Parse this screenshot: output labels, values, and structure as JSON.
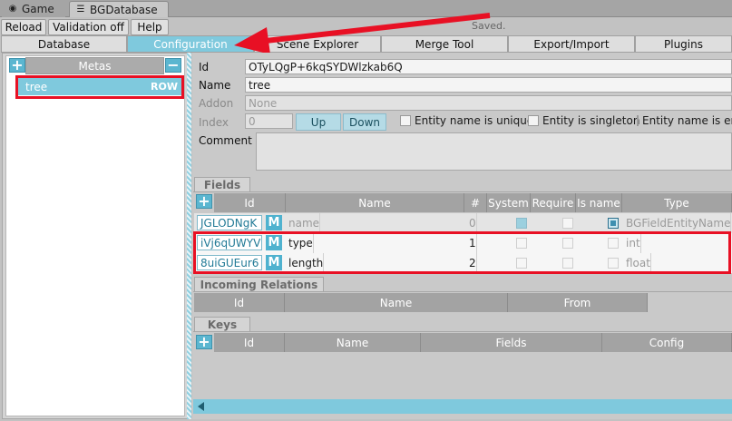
{
  "window_tabs": [
    {
      "label": "Game",
      "icon": "gamepad-icon"
    },
    {
      "label": "BGDatabase",
      "icon": "list-icon"
    }
  ],
  "toolbar": {
    "reload": "Reload",
    "validation": "Validation off",
    "help": "Help",
    "status": "Saved."
  },
  "nav_tabs": [
    "Database",
    "Configuration",
    "Scene Explorer",
    "Merge Tool",
    "Export/Import",
    "Plugins"
  ],
  "nav_selected": "Configuration",
  "metas": {
    "header": "Metas",
    "items": [
      {
        "name": "tree",
        "kind": "ROW"
      }
    ]
  },
  "form": {
    "id_label": "Id",
    "id_value": "OTyLQgP+6kqSYDWlzkab6Q",
    "name_label": "Name",
    "name_value": "tree",
    "addon_label": "Addon",
    "addon_value": "None",
    "index_label": "Index",
    "index_value": "0",
    "up_label": "Up",
    "down_label": "Down",
    "checks": [
      "Entity name is unique",
      "Entity is singleton",
      "Entity name is em"
    ],
    "comment_label": "Comment"
  },
  "fields": {
    "tab": "Fields",
    "columns": [
      "Id",
      "Name",
      "#",
      "System",
      "Require",
      "Is name",
      "Type"
    ],
    "rows": [
      {
        "id": "JGLODNgK",
        "name": "name",
        "num": "0",
        "system": true,
        "require": false,
        "isname": true,
        "type": "BGFieldEntityName",
        "dim": true
      },
      {
        "id": "iVj6qUWYV",
        "name": "type",
        "num": "1",
        "system": false,
        "require": false,
        "isname": false,
        "type": "int",
        "dim": false
      },
      {
        "id": "8uiGUEur6",
        "name": "length",
        "num": "2",
        "system": false,
        "require": false,
        "isname": false,
        "type": "float",
        "dim": false
      }
    ]
  },
  "incoming": {
    "tab": "Incoming Relations",
    "columns": [
      "Id",
      "Name",
      "From"
    ]
  },
  "keys": {
    "tab": "Keys",
    "columns": [
      "Id",
      "Name",
      "Fields",
      "Config"
    ]
  },
  "colors": {
    "accent": "#7fc9dd",
    "highlight": "#e81024"
  }
}
